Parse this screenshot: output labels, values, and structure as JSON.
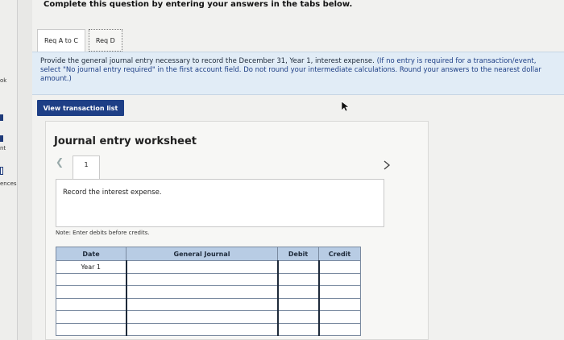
{
  "sidebar_fragments": {
    "a": "ok",
    "b": "nt",
    "c": "ences"
  },
  "instructions": "Complete this question by entering your answers in the tabs below.",
  "tabs": [
    {
      "label": "Req A to C",
      "active": true
    },
    {
      "label": "Req D",
      "active": false
    }
  ],
  "question": {
    "text": "Provide the general journal entry necessary to record the December 31, Year 1, interest expense.",
    "hint": "(If no entry is required for a transaction/event, select \"No journal entry required\" in the first account field. Do not round your intermediate calculations. Round your answers to the nearest dollar amount.)"
  },
  "view_transaction_label": "View transaction list",
  "worksheet": {
    "title": "Journal entry worksheet",
    "page": "1",
    "entry_description": "Record the interest expense.",
    "note": "Note: Enter debits before credits."
  },
  "journal": {
    "headers": {
      "date": "Date",
      "general_journal": "General Journal",
      "debit": "Debit",
      "credit": "Credit"
    },
    "rows": [
      {
        "date": "Year 1",
        "account": "",
        "debit": "",
        "credit": ""
      },
      {
        "date": "",
        "account": "",
        "debit": "",
        "credit": ""
      },
      {
        "date": "",
        "account": "",
        "debit": "",
        "credit": ""
      },
      {
        "date": "",
        "account": "",
        "debit": "",
        "credit": ""
      },
      {
        "date": "",
        "account": "",
        "debit": "",
        "credit": ""
      },
      {
        "date": "",
        "account": "",
        "debit": "",
        "credit": ""
      }
    ]
  },
  "colors": {
    "accent": "#1e3f86",
    "question_bg": "#e1ecf6",
    "table_header": "#b8cce4"
  },
  "icons": [
    "chevron-left-icon",
    "chevron-right-icon",
    "cursor-icon"
  ]
}
